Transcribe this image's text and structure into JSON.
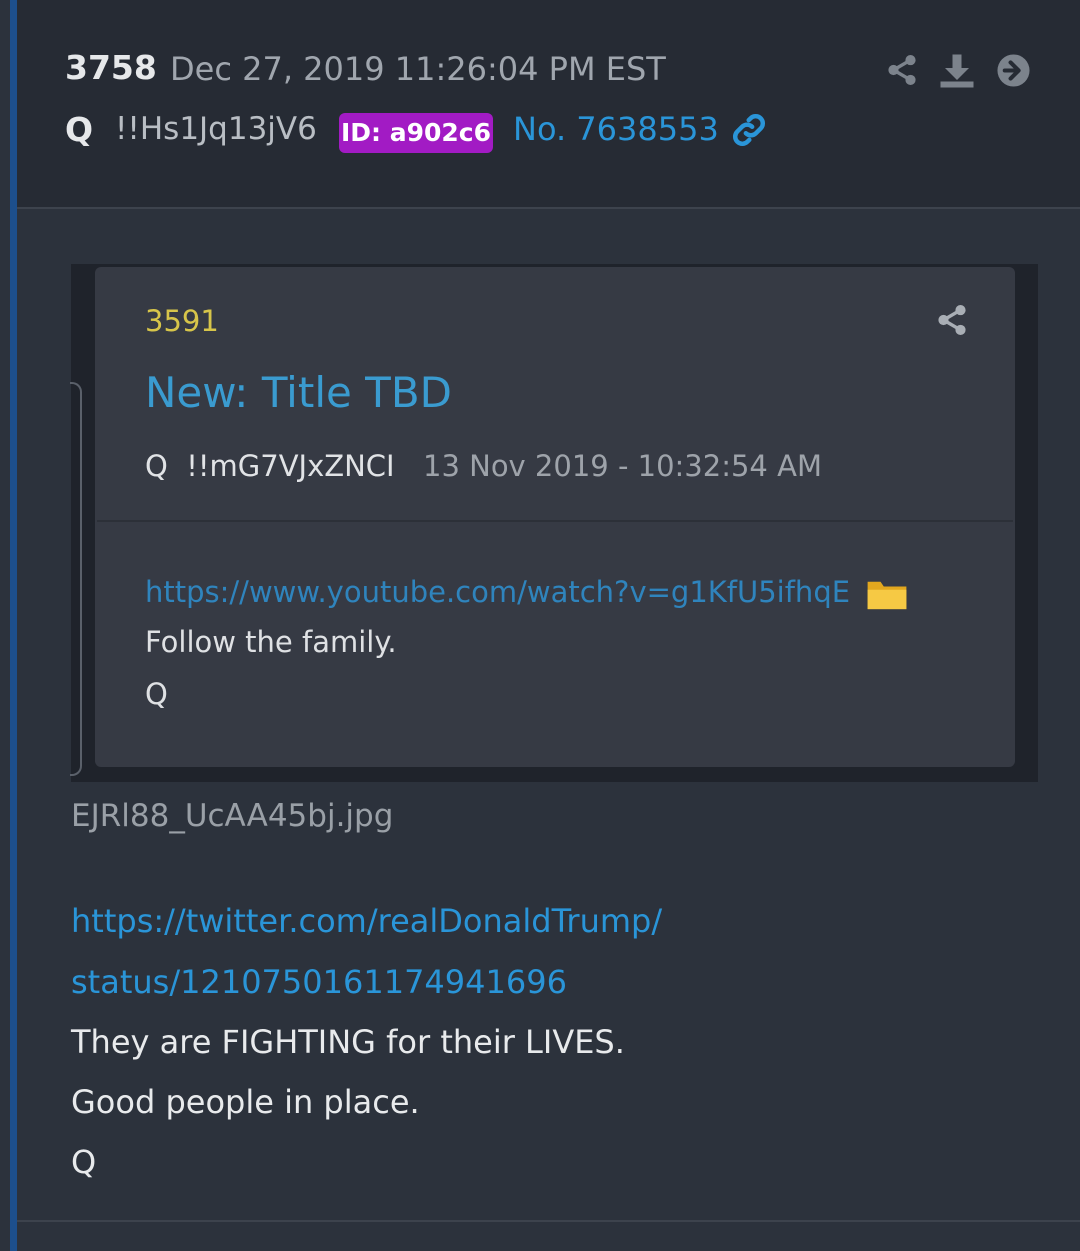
{
  "header": {
    "post_number": "3758",
    "date": "Dec 27, 2019 11:26:04 PM EST",
    "author": "Q",
    "tripcode": "!!Hs1Jq13jV6",
    "id_badge": "ID: a902c6",
    "post_no": "No. 7638553",
    "toolbar_icons": [
      "share-icon",
      "download-icon",
      "arrow-right-circle-icon"
    ]
  },
  "embedded_post": {
    "number": "3591",
    "title": "New: Title TBD",
    "author": "Q",
    "tripcode": "!!mG7VJxZNCI",
    "date": "13 Nov 2019 - 10:32:54 AM",
    "link": "https://www.youtube.com/watch?v=g1KfU5ifhqE",
    "lines": [
      "Follow the family.",
      "Q"
    ]
  },
  "attachment": {
    "filename": "EJRl88_UcAA45bj.jpg"
  },
  "body": {
    "link_line1": "https://twitter.com/realDonaldTrump/",
    "link_line2": "status/1210750161174941696",
    "lines": [
      "They are FIGHTING for their LIVES.",
      "Good people in place.",
      "Q"
    ]
  },
  "colors": {
    "background": "#2c323c",
    "header_bg": "#262b34",
    "link": "#2a95d8",
    "id_badge": "#a21bc4",
    "inner_number": "#d7c54a",
    "accent_bar": "#1d4f8c"
  }
}
